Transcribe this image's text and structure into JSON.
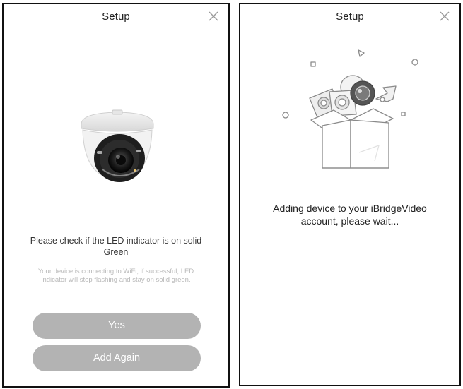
{
  "left_screen": {
    "title": "Setup",
    "close_icon": "close-icon",
    "image": "dome-camera-icon",
    "prompt": "Please check if the LED indicator is on solid Green",
    "hint": "Your device is connecting to WiFi, if successful, LED indicator will stop flashing and stay on solid green.",
    "yes_button": "Yes",
    "add_again_button": "Add Again",
    "button_color": "#b3b3b3"
  },
  "right_screen": {
    "title": "Setup",
    "close_icon": "close-icon",
    "image": "gift-box-icon",
    "status": "Adding device to your iBridgeVideo account, please wait..."
  }
}
